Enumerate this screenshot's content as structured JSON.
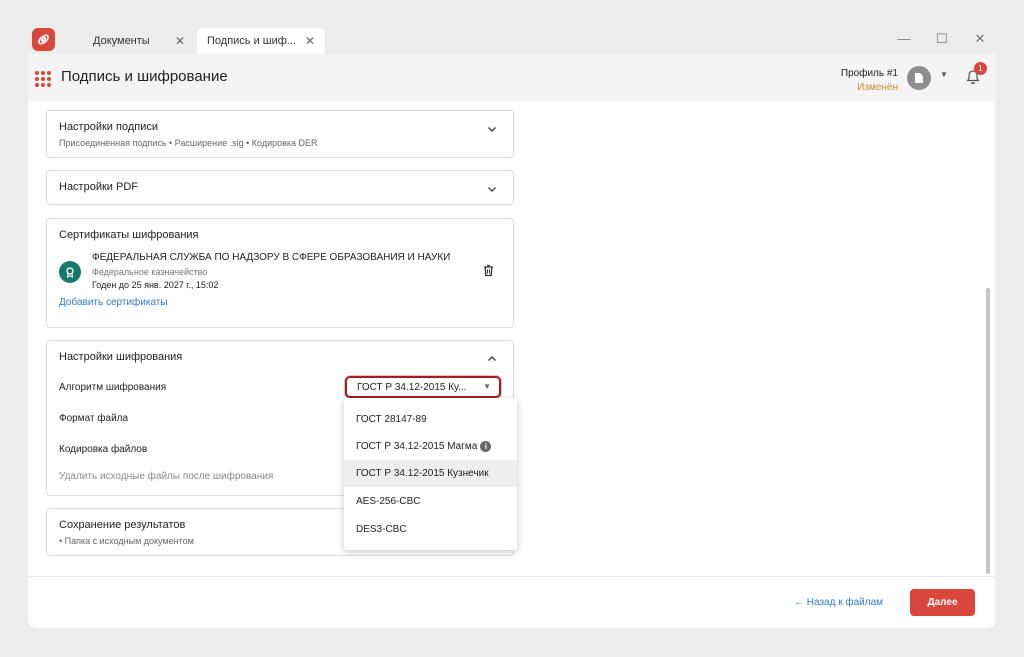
{
  "tabs": [
    {
      "label": "Документы"
    },
    {
      "label": "Подпись и шиф..."
    }
  ],
  "window_controls": {
    "minimize": "—",
    "maximize": "☐",
    "close": "✕"
  },
  "header": {
    "title": "Подпись и шифрование",
    "profile_name": "Профиль #1",
    "profile_status": "Изменён",
    "notification_count": "1"
  },
  "signature_settings": {
    "title": "Настройки подписи",
    "summary": "Присоединенная подпись • Расширение .sig • Кодировка DER"
  },
  "pdf_settings": {
    "title": "Настройки PDF"
  },
  "encryption_certs": {
    "title": "Сертификаты шифрования",
    "cert": {
      "name": "ФЕДЕРАЛЬНАЯ СЛУЖБА ПО НАДЗОРУ В СФЕРЕ ОБРАЗОВАНИЯ И НАУКИ",
      "issuer": "Федеральное казначейство",
      "valid_until": "Годен до 25 янв. 2027 г., 15:02"
    },
    "add_link": "Добавить сертификаты"
  },
  "encryption_settings": {
    "title": "Настройки шифрования",
    "algorithm_label": "Алгоритм шифрования",
    "algorithm_value": "ГОСТ Р 34.12-2015 Ку...",
    "file_format_label": "Формат файла",
    "encoding_label": "Кодировка файлов",
    "delete_source_label": "Удалить исходные файлы после шифрования"
  },
  "algorithm_options": [
    {
      "label": "ГОСТ 28147-89"
    },
    {
      "label": "ГОСТ Р 34.12-2015 Магма"
    },
    {
      "label": "ГОСТ Р 34.12-2015 Кузнечик"
    },
    {
      "label": "AES-256-CBC"
    },
    {
      "label": "DES3-CBC"
    }
  ],
  "save_results": {
    "title": "Сохранение результатов",
    "summary": "• Папка с исходным документом"
  },
  "footer": {
    "back_label": "← Назад к файлам",
    "next_label": "Далее"
  },
  "colors": {
    "accent": "#d9463b",
    "link": "#2f7bd0",
    "cert_icon": "#17796d",
    "status": "#d08a2c"
  }
}
